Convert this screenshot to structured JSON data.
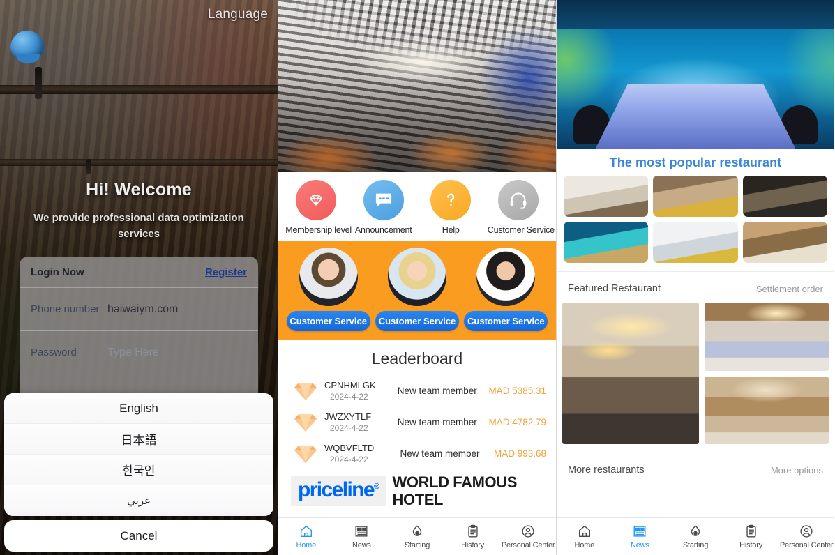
{
  "login_screen": {
    "language_button": "Language",
    "welcome_title": "Hi! Welcome",
    "welcome_subtitle": "We provide professional data optimization services",
    "card": {
      "title": "Login Now",
      "register_link": "Register",
      "phone_label": "Phone number",
      "phone_value": "haiwaiym.com",
      "password_label": "Password",
      "password_placeholder": "Type Here"
    },
    "language_sheet": {
      "options": [
        "English",
        "日本語",
        "한국인",
        "عربي"
      ],
      "cancel": "Cancel"
    }
  },
  "home_screen": {
    "quick_actions": [
      {
        "label": "Membership level",
        "icon": "diamond-icon",
        "color": "#f05b5b"
      },
      {
        "label": "Announcement",
        "icon": "message-icon",
        "color": "#4a9fe0"
      },
      {
        "label": "Help",
        "icon": "question-icon",
        "color": "#f9a825"
      },
      {
        "label": "Customer Service",
        "icon": "headset-icon",
        "color": "#a7a7a7"
      }
    ],
    "customer_service": {
      "band_color": "#f99c20",
      "buttons": [
        "Customer Service",
        "Customer Service",
        "Customer Service"
      ]
    },
    "leaderboard": {
      "title": "Leaderboard",
      "rows": [
        {
          "id": "CPNHMLGK",
          "date": "2024-4-22",
          "event": "New team member",
          "amount": "MAD 5385.31"
        },
        {
          "id": "JWZXYTLF",
          "date": "2024-4-22",
          "event": "New team member",
          "amount": "MAD 4782.79"
        },
        {
          "id": "WQBVFLTD",
          "date": "2024-4-22",
          "event": "New team member",
          "amount": "MAD 993.68"
        }
      ],
      "amount_color": "#f0a23a"
    },
    "banner": {
      "logo_text": "priceline",
      "logo_mark": "®",
      "headline": "WORLD FAMOUS HOTEL"
    },
    "bottom_nav": {
      "active": "Home",
      "items": [
        {
          "label": "Home",
          "icon": "home-icon"
        },
        {
          "label": "News",
          "icon": "news-icon"
        },
        {
          "label": "Starting",
          "icon": "flame-icon"
        },
        {
          "label": "History",
          "icon": "clipboard-icon"
        },
        {
          "label": "Personal Center",
          "icon": "user-icon"
        }
      ]
    }
  },
  "news_screen": {
    "popular_title": "The most popular restaurant",
    "popular_title_color": "#3a87d8",
    "featured": {
      "heading": "Featured Restaurant",
      "action": "Settlement order"
    },
    "more": {
      "heading": "More restaurants",
      "action": "More options"
    },
    "bottom_nav": {
      "active": "News",
      "items": [
        {
          "label": "Home",
          "icon": "home-icon"
        },
        {
          "label": "News",
          "icon": "news-icon"
        },
        {
          "label": "Starting",
          "icon": "flame-icon"
        },
        {
          "label": "History",
          "icon": "clipboard-icon"
        },
        {
          "label": "Personal Center",
          "icon": "user-icon"
        }
      ]
    }
  }
}
